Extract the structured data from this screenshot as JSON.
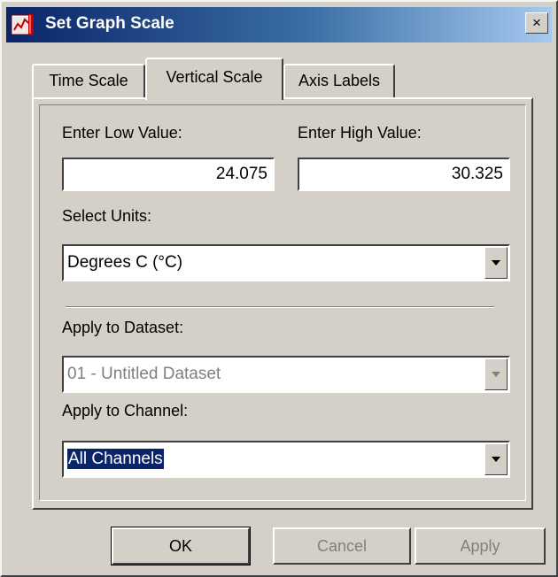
{
  "window": {
    "title": "Set Graph Scale",
    "close_label": "×"
  },
  "tabs": [
    {
      "label": "Time Scale",
      "active": false
    },
    {
      "label": "Vertical Scale",
      "active": true
    },
    {
      "label": "Axis Labels",
      "active": false
    }
  ],
  "vertical_scale": {
    "low_label": "Enter Low Value:",
    "low_value": "24.075",
    "high_label": "Enter High Value:",
    "high_value": "30.325",
    "units_label": "Select Units:",
    "units_value": "Degrees C (°C)",
    "dataset_label": "Apply to Dataset:",
    "dataset_value": "01 - Untitled Dataset",
    "dataset_enabled": false,
    "channel_label": "Apply to Channel:",
    "channel_value": "All Channels"
  },
  "buttons": {
    "ok": "OK",
    "cancel": "Cancel",
    "apply": "Apply"
  },
  "colors": {
    "title_bar": "#0a246a",
    "face": "#d4d0c8",
    "selection": "#0a246a",
    "disabled_text": "#808080"
  },
  "icons": {
    "app": "graph-app-icon",
    "close": "close-icon",
    "dropdown": "chevron-down-icon"
  }
}
